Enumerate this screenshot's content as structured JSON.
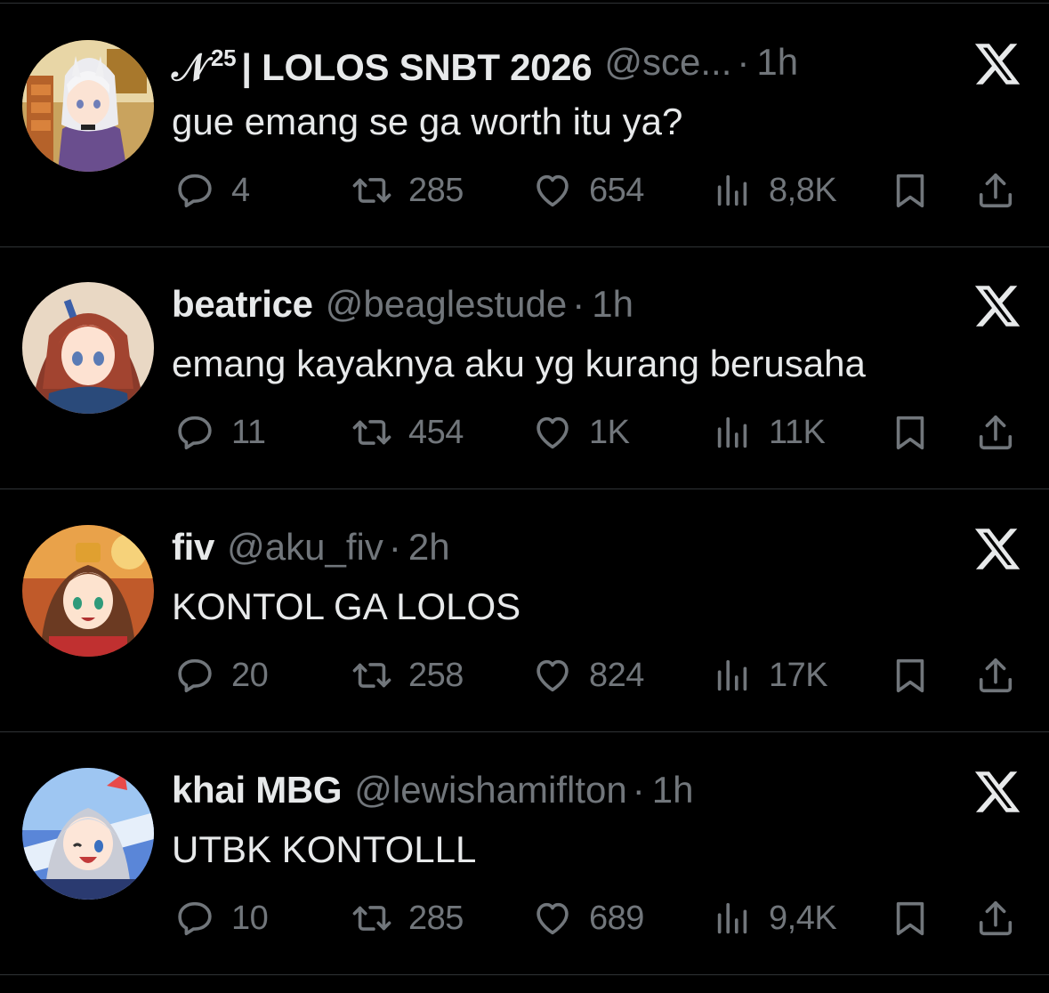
{
  "colors": {
    "background": "#000000",
    "primary_text": "#e7e9ea",
    "secondary_text": "#71767b",
    "divider": "#2f3336"
  },
  "icons": {
    "reply": "speech-bubble-icon",
    "retweet": "retweet-arrows-icon",
    "like": "heart-icon",
    "views": "bar-chart-icon",
    "bookmark": "bookmark-icon",
    "share": "share-upload-icon",
    "dismiss": "x-logo-icon"
  },
  "tweets": [
    {
      "display_name_prefix": "𝒩",
      "display_name_sup": "25",
      "display_name": "| LOLOS SNBT 2026",
      "handle": "@sce...",
      "separator": "·",
      "time": "1h",
      "text": "gue emang se ga worth itu ya?",
      "replies": "4",
      "retweets": "285",
      "likes": "654",
      "views": "8,8K"
    },
    {
      "display_name_prefix": "",
      "display_name_sup": "",
      "display_name": "beatrice",
      "handle": "@beaglestude",
      "separator": "·",
      "time": "1h",
      "text": "emang kayaknya aku yg kurang berusaha",
      "replies": "11",
      "retweets": "454",
      "likes": "1K",
      "views": "11K"
    },
    {
      "display_name_prefix": "",
      "display_name_sup": "",
      "display_name": "fiv",
      "handle": "@aku_fiv",
      "separator": "·",
      "time": "2h",
      "text": "KONTOL GA LOLOS",
      "replies": "20",
      "retweets": "258",
      "likes": "824",
      "views": "17K"
    },
    {
      "display_name_prefix": "",
      "display_name_sup": "",
      "display_name": "khai MBG",
      "handle": "@lewishamiflton",
      "separator": "·",
      "time": "1h",
      "text": "UTBK KONTOLLL",
      "replies": "10",
      "retweets": "285",
      "likes": "689",
      "views": "9,4K"
    }
  ]
}
